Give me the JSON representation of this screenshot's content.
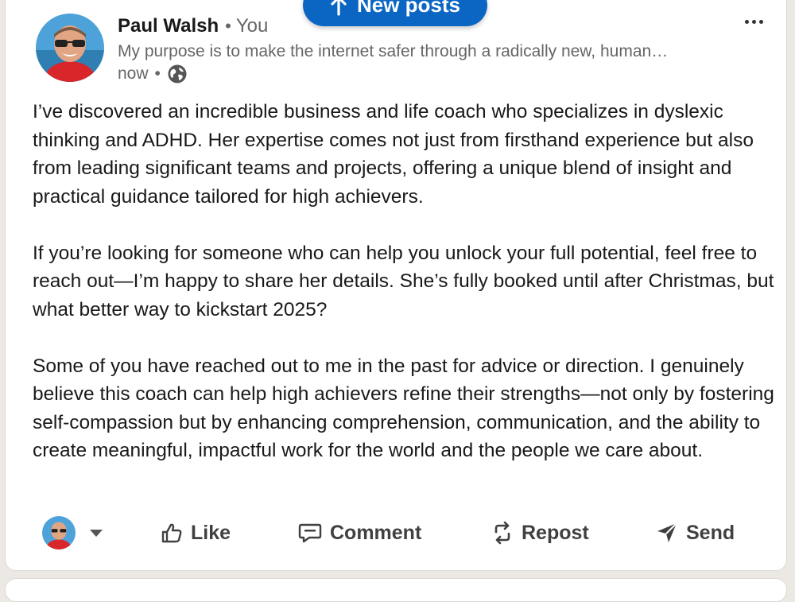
{
  "banner": {
    "new_posts_label": "New posts",
    "icon": "arrow-up-icon"
  },
  "post": {
    "author": {
      "name": "Paul Walsh",
      "separator": "•",
      "relation": "You",
      "headline": "My purpose is to make the internet safer through a radically new, human…",
      "avatar_icon": "profile-photo"
    },
    "time": "now",
    "time_separator": "•",
    "visibility_icon": "globe-icon",
    "more_icon": "more-options-icon",
    "paragraphs": [
      "I’ve discovered an incredible business and life coach who specializes in dyslexic thinking and ADHD. Her expertise comes not just from firsthand experience but also from leading significant teams and projects, offering a unique blend of insight and practical guidance tailored for high achievers.",
      "If you’re looking for someone who can help you unlock your full potential, feel free to reach out—I’m happy to share her details. She’s fully booked until after Christmas, but what better way to kickstart 2025?",
      "Some of you have reached out to me in the past for advice or direction. I genuinely believe this coach can help high achievers refine their strengths—not only by fostering self-compassion but by enhancing comprehension, communication, and the ability to create meaningful, impactful work for the world and the people we care about."
    ]
  },
  "actions": {
    "like": "Like",
    "comment": "Comment",
    "repost": "Repost",
    "send": "Send"
  },
  "colors": {
    "brand_blue": "#0a66c2",
    "text": "#191919",
    "muted": "#666666"
  }
}
